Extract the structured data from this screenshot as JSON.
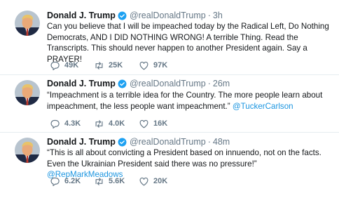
{
  "tweets": [
    {
      "name": "Donald J. Trump",
      "handle": "@realDonaldTrump",
      "dot": "·",
      "time": "3h",
      "text": "Can you believe that I will be impeached today by the Radical Left, Do Nothing Democrats, AND I DID NOTHING WRONG! A terrible Thing. Read the Transcripts. This should never happen to another President again. Say a PRAYER!",
      "mention": "",
      "replies": "49K",
      "retweets": "25K",
      "likes": "97K"
    },
    {
      "name": "Donald J. Trump",
      "handle": "@realDonaldTrump",
      "dot": "·",
      "time": "26m",
      "text": "“Impeachment is a terrible idea for the Country. The more people learn about impeachment, the less people want impeachment.”",
      "mention": "@TuckerCarlson",
      "replies": "4.3K",
      "retweets": "4.0K",
      "likes": "16K"
    },
    {
      "name": "Donald J. Trump",
      "handle": "@realDonaldTrump",
      "dot": "·",
      "time": "48m",
      "text": "“This is all about convicting a President based on innuendo, not on the facts. Even the Ukrainian President said there was no pressure!”",
      "mention": "@RepMarkMeadows",
      "replies": "6.2K",
      "retweets": "5.6K",
      "likes": "20K"
    }
  ],
  "colors": {
    "text": "#14171a",
    "secondary": "#657786",
    "link": "#1b95e0",
    "divider": "#e6ecf0",
    "verified": "#1da1f2"
  },
  "icons": {
    "verified": "verified-badge-icon",
    "reply": "reply-icon",
    "retweet": "retweet-icon",
    "like": "heart-icon"
  }
}
